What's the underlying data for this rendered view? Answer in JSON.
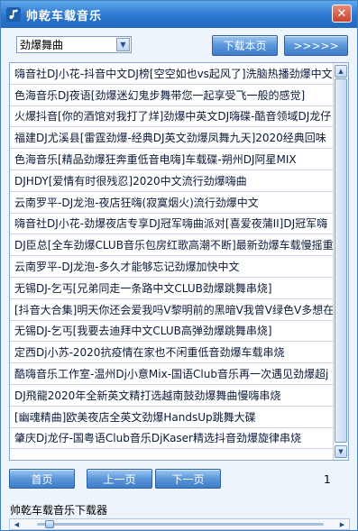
{
  "window": {
    "title": "帅乾车载音乐",
    "close_glyph": "✕",
    "icon": "music-note-icon"
  },
  "toolbar": {
    "genre_select": {
      "value": "劲爆舞曲"
    },
    "download_label": "下载本页",
    "more_label": ">>>>>"
  },
  "songs": [
    "嗨音社DJ小花-抖音中文DJ榜[空空如也vs起风了]洗脑热播劲爆中文",
    "色海音乐DJ夜语[劲爆迷幻鬼步舞带您一起享受飞一般的感觉]",
    "火爆抖音[你的酒馆对我打了烊]劲爆中英文DJ嗨碟-酷音领域DJ龙仔",
    "福建DJ尤溪县[雷霆劲爆-经典DJ英文劲爆凤舞九天]2020经典回味",
    "色海音乐[精品劲爆狂奔重低音电嗨]车载碟-朔州DJ阿星MIX",
    "DJHDY[爱情有时很残忍]2020中文流行劲爆嗨曲",
    "云南罗平-DJ龙泡-夜店狂嗨(寂寞烟火)流行劲爆中文",
    "嗨音社DJ小花-劲爆夜店专享DJ冠军嗨曲派对[喜爱夜蒲II]DJ冠军嗨",
    "DJ臣总[全车劲爆CLUB音乐包房红歌高潮不断]最新劲爆车载慢摇重",
    "云南罗平-DJ龙泡-多久才能够忘记劲爆加快中文",
    "无锡DJ-乞丐[兄弟同走一条路中文CLUB劲爆跳舞串烧]",
    "[抖音大合集]明天你还会爱我吗V黎明前的黑暗V我曾V绿色V多想在",
    "无锡DJ-乞丐[我要去迪拜中文CLUB高弹劲爆跳舞串烧]",
    "定西Dj小苏-2020抗疫情在家也不闲重低音劲爆车载串烧",
    "酷嗨音乐工作室-温州Dj小意Mix-国语Club音乐再一次遇见劲爆超j",
    "DJ飛龍2020年全新英文精打选越南鼓劲爆舞曲慢嗨串烧",
    "[幽魂精曲]欧美夜店全英文劲爆HandsUp跳舞大碟",
    "肇庆Dj龙仔-国粤语Club音乐DjKaser精选抖音劲爆旋律串烧"
  ],
  "list_scrollbar": {
    "up_glyph": "▲",
    "down_glyph": "▼"
  },
  "pagination": {
    "first_label": "首页",
    "prev_label": "上一页",
    "next_label": "下一页",
    "page_number": "1"
  },
  "status": {
    "label": "帅乾车载音乐下载器"
  },
  "progress": {
    "left_glyph": "◀",
    "right_glyph": "▶",
    "position_fraction": 0.03
  }
}
